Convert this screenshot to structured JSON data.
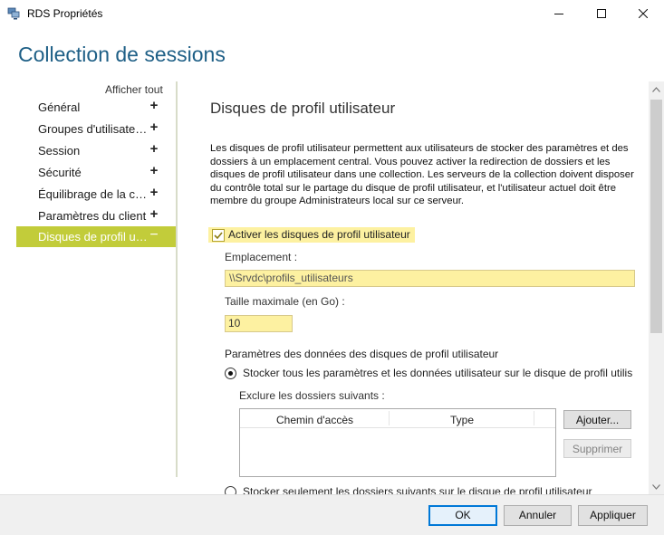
{
  "window": {
    "title": "RDS Propriétés"
  },
  "heading": "Collection de sessions",
  "nav": {
    "show_all": "Afficher tout",
    "items": [
      {
        "label": "Général",
        "sign": "+"
      },
      {
        "label": "Groupes d'utilisateurs",
        "sign": "+"
      },
      {
        "label": "Session",
        "sign": "+"
      },
      {
        "label": "Sécurité",
        "sign": "+"
      },
      {
        "label": "Équilibrage de la charge",
        "sign": "+"
      },
      {
        "label": "Paramètres du client",
        "sign": "+"
      },
      {
        "label": "Disques de profil utilisateur",
        "sign": "−",
        "selected": true
      }
    ]
  },
  "content": {
    "section_title": "Disques de profil utilisateur",
    "description": "Les disques de profil utilisateur permettent aux utilisateurs de stocker des paramètres et des dossiers à un emplacement central. Vous pouvez activer la redirection de dossiers et les disques de profil utilisateur dans une collection. Les serveurs de la collection doivent disposer du contrôle total sur le partage du disque de profil utilisateur, et l'utilisateur actuel doit être membre du groupe Administrateurs local sur ce serveur.",
    "enable_label": "Activer les disques de profil utilisateur",
    "enable_checked": true,
    "location_label": "Emplacement :",
    "location_value": "\\\\Srvdc\\profils_utilisateurs",
    "max_size_label": "Taille maximale (en Go) :",
    "max_size_value": "10",
    "params_title": "Paramètres des données des disques de profil utilisateur",
    "radio_all_label": "Stocker tous les paramètres et les données utilisateur sur le disque de profil utilisateur",
    "exclude_label": "Exclure les dossiers suivants :",
    "table_columns": [
      "Chemin d'accès",
      "Type"
    ],
    "add_button": "Ajouter...",
    "remove_button": "Supprimer",
    "radio_some_label": "Stocker seulement les dossiers suivants sur le disque de profil utilisateur"
  },
  "footer": {
    "ok": "OK",
    "cancel": "Annuler",
    "apply": "Appliquer"
  },
  "colors": {
    "accent": "#c2cc3a",
    "highlight": "#fdf1a1",
    "heading": "#1e5f86",
    "ok_border": "#0078d7"
  }
}
